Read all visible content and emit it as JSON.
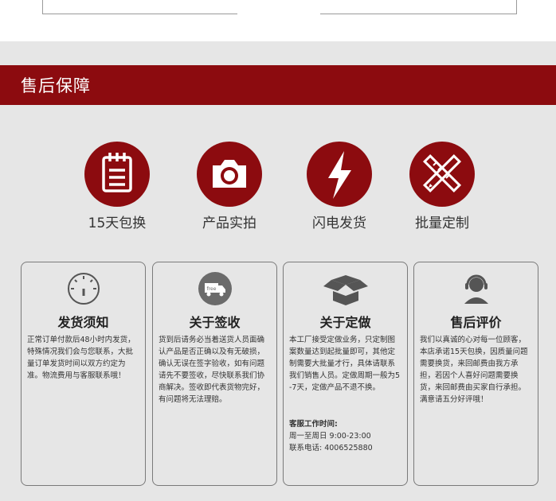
{
  "banner": {
    "title": "售后保障"
  },
  "features": [
    {
      "label": "15天包换",
      "icon": "notepad-icon"
    },
    {
      "label": "产品实拍",
      "icon": "camera-icon"
    },
    {
      "label": "闪电发货",
      "icon": "lightning-icon"
    },
    {
      "label": "批量定制",
      "icon": "pencil-ruler-icon"
    }
  ],
  "cards": [
    {
      "title": "发货须知",
      "icon": "gauge-icon",
      "text": "正常订单付款后48小时内发货，特殊情况我们会与您联系，大批量订单发货时间以双方约定为准。物流费用与客服联系哦！"
    },
    {
      "title": "关于签收",
      "icon": "free-truck-icon",
      "text": "货到后请务必当着送货人员面确认产品是否正确以及有无破损，确认无误在签字验收，如有问题请先不要签收，尽快联系我们协商解决。签收即代表货物完好，有问题将无法理赔。"
    },
    {
      "title": "关于定做",
      "icon": "open-box-icon",
      "text": "本工厂接受定做业务，只定制图案数量达到起批量即可，其他定制需要大批量才行，具体请联系我们销售人员。定做周期一般为5-7天，定做产品不退不换。",
      "service_heading": "客服工作时间:",
      "service_hours": "周一至周日 9:00-23:00",
      "service_phone": "联系电话: 4006525880"
    },
    {
      "title": "售后评价",
      "icon": "headset-agent-icon",
      "text": "我们以真诚的心对每一位顾客，本店承诺15天包换，因质量问题需要换货，来回邮费由我方承担，若因个人喜好问题需要换货，来回邮费由买家自行承担。满意请五分好评哦！"
    }
  ],
  "colors": {
    "brand": "#8c0b0f",
    "background": "#e6e6e6"
  }
}
